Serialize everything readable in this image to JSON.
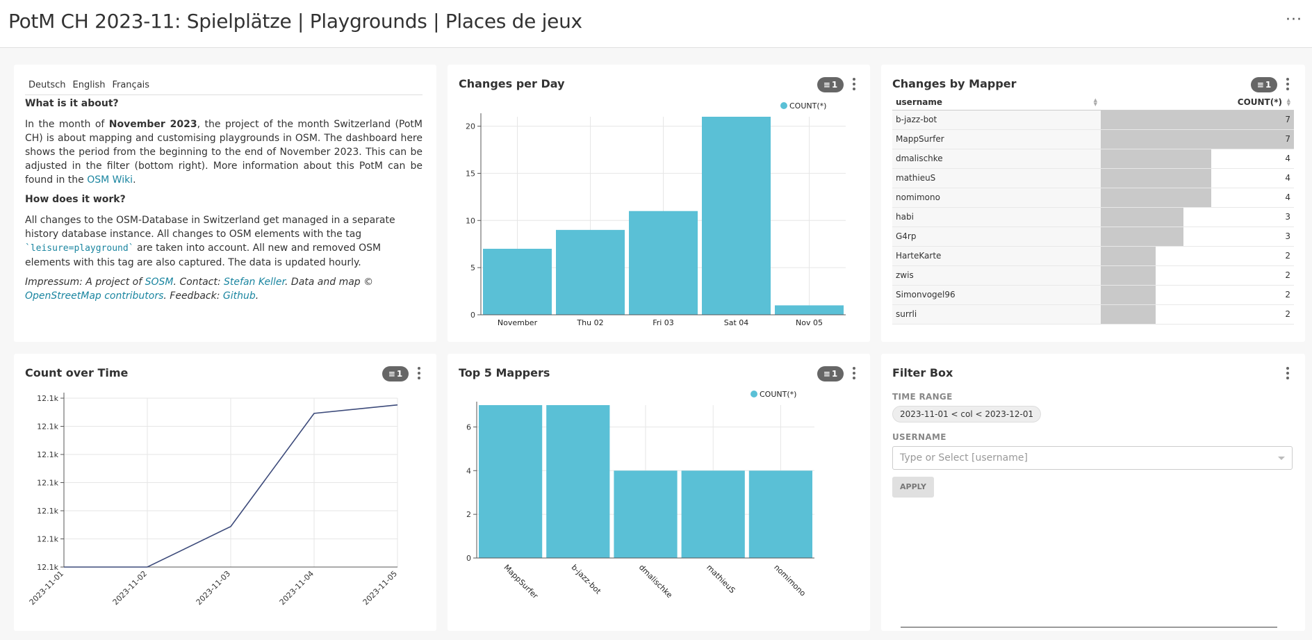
{
  "header": {
    "title": "PotM CH 2023-11: Spielplätze | Playgrounds | Places de jeux",
    "more_icon": "more-horizontal-icon"
  },
  "text_panel": {
    "tabs": [
      "Deutsch",
      "English",
      "Français"
    ],
    "h1": "What is it about?",
    "p1_a": "In the month of ",
    "p1_bold": "November 2023",
    "p1_b": ", the project of the month Switzerland (PotM CH) is about mapping and customising playgrounds in OSM. The dashboard here shows the period from the beginning to the end of November 2023. This can be adjusted in the filter (bottom right). More information about this PotM can be found in the ",
    "p1_link": "OSM Wiki",
    "p1_end": ".",
    "h2": "How does it work?",
    "p2_a": "All changes to the OSM-Database in Switzerland get managed in a separate history database instance. All changes to OSM elements with the tag ",
    "p2_code": "`leisure=playground`",
    "p2_b": " are taken into account. All new and removed OSM elements with this tag are also captured. The data is updated hourly.",
    "p3_a": "Impressum: A project of ",
    "p3_link1": "SOSM",
    "p3_b": ". Contact: ",
    "p3_link2": "Stefan Keller",
    "p3_c": ". Data and map © ",
    "p3_link3": "OpenStreetMap contributors",
    "p3_d": ". Feedback: ",
    "p3_link4": "Github",
    "p3_e": "."
  },
  "changes_per_day": {
    "title": "Changes per Day",
    "filter_count": "1",
    "legend": "COUNT(*)",
    "chart_data": {
      "type": "bar",
      "categories": [
        "November",
        "Thu 02",
        "Fri 03",
        "Sat 04",
        "Nov 05"
      ],
      "series": [
        {
          "name": "COUNT(*)",
          "values": [
            7,
            9,
            11,
            21,
            1
          ]
        }
      ],
      "ylim": [
        0,
        21
      ],
      "yticks": [
        0,
        5,
        10,
        15,
        20
      ],
      "color": "#5ac0d6",
      "grid": true,
      "legend": "top-right"
    }
  },
  "changes_by_mapper": {
    "title": "Changes by Mapper",
    "filter_count": "1",
    "columns": [
      "username",
      "COUNT(*)"
    ],
    "rows": [
      {
        "username": "b-jazz-bot",
        "count": 7
      },
      {
        "username": "MappSurfer",
        "count": 7
      },
      {
        "username": "dmalischke",
        "count": 4
      },
      {
        "username": "mathieuS",
        "count": 4
      },
      {
        "username": "nomimono",
        "count": 4
      },
      {
        "username": "habi",
        "count": 3
      },
      {
        "username": "G4rp",
        "count": 3
      },
      {
        "username": "HarteKarte",
        "count": 2
      },
      {
        "username": "zwis",
        "count": 2
      },
      {
        "username": "Simonvogel96",
        "count": 2
      },
      {
        "username": "surrli",
        "count": 2
      }
    ],
    "max": 7
  },
  "count_over_time": {
    "title": "Count over Time",
    "filter_count": "1",
    "chart_data": {
      "type": "line",
      "x": [
        "2023-11-01",
        "2023-11-02",
        "2023-11-03",
        "2023-11-04",
        "2023-11-05"
      ],
      "y_rel": [
        0.0,
        0.0,
        0.24,
        0.91,
        0.96
      ],
      "yticks": [
        "12.1k",
        "12.1k",
        "12.1k",
        "12.1k",
        "12.1k",
        "12.1k",
        "12.1k"
      ],
      "color": "#3c4a7a",
      "grid": true
    }
  },
  "top5": {
    "title": "Top 5 Mappers",
    "filter_count": "1",
    "legend": "COUNT(*)",
    "chart_data": {
      "type": "bar",
      "categories": [
        "MappSurfer",
        "b-jazz-bot",
        "dmalischke",
        "mathieuS",
        "nomimono"
      ],
      "series": [
        {
          "name": "COUNT(*)",
          "values": [
            7,
            7,
            4,
            4,
            4
          ]
        }
      ],
      "ylim": [
        0,
        7
      ],
      "yticks": [
        0,
        2,
        4,
        6
      ],
      "color": "#5ac0d6",
      "grid": true,
      "legend": "top-right"
    }
  },
  "filter_box": {
    "title": "Filter Box",
    "time_range_label": "TIME RANGE",
    "time_range_value": "2023-11-01 < col < 2023-12-01",
    "username_label": "USERNAME",
    "username_placeholder": "Type or Select [username]",
    "apply": "APPLY"
  }
}
